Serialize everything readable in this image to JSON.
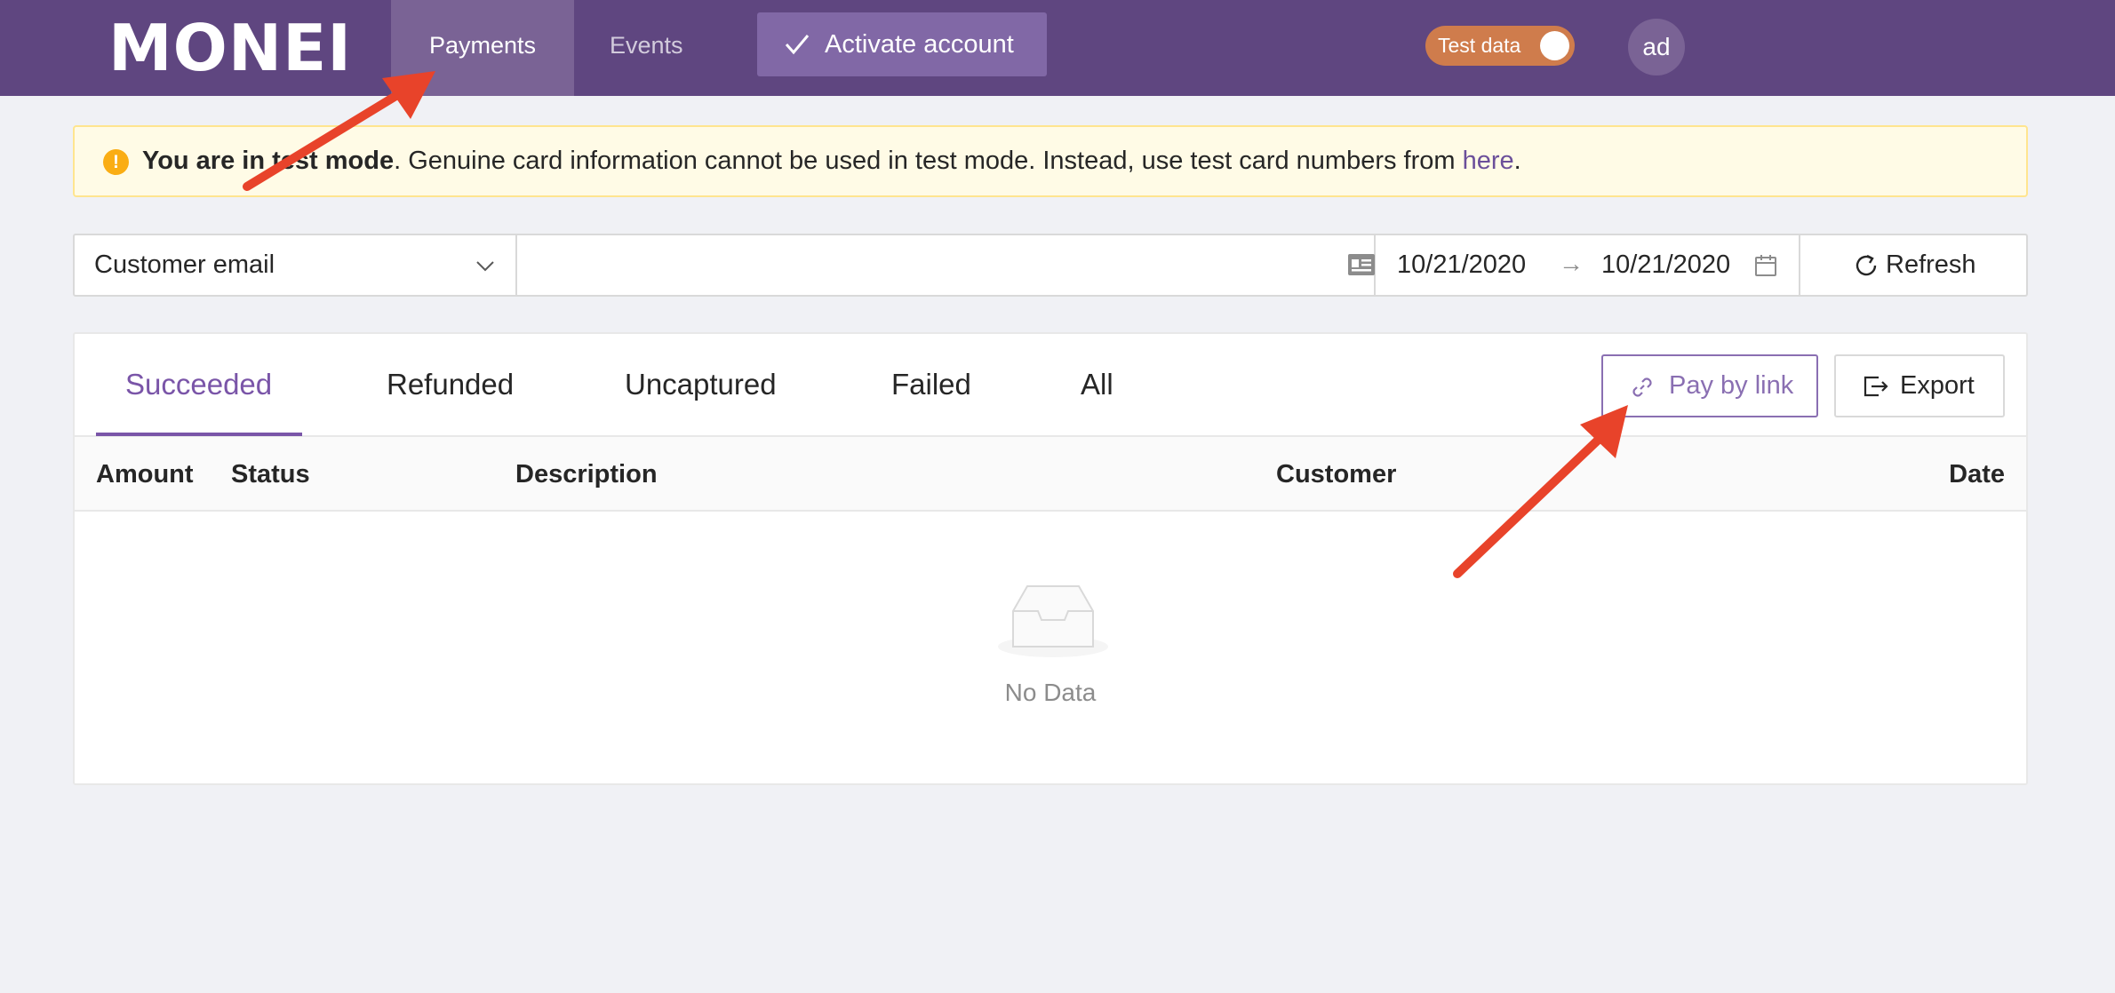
{
  "header": {
    "logo": "MONEI",
    "nav": [
      {
        "label": "Payments"
      },
      {
        "label": "Events"
      }
    ],
    "activate_label": "Activate account",
    "test_toggle_label": "Test data",
    "avatar_initials": "ad"
  },
  "alert": {
    "bold": "You are in test mode",
    "text": ". Genuine card information cannot be used in test mode. Instead, use test card numbers from ",
    "link": "here",
    "end": "."
  },
  "filters": {
    "field_select": "Customer email",
    "search_value": "",
    "date_from": "10/21/2020",
    "date_arrow": "→",
    "date_to": "10/21/2020",
    "refresh_label": "Refresh"
  },
  "tabs": [
    {
      "label": "Succeeded"
    },
    {
      "label": "Refunded"
    },
    {
      "label": "Uncaptured"
    },
    {
      "label": "Failed"
    },
    {
      "label": "All"
    }
  ],
  "actions": {
    "pay_by_link_label": "Pay by link",
    "export_label": "Export"
  },
  "table": {
    "columns": [
      "Amount",
      "Status",
      "Description",
      "Customer",
      "Date"
    ],
    "empty_text": "No Data"
  },
  "colors": {
    "header_bg": "#5f4680",
    "accent": "#7a55a8",
    "test_toggle": "#cf7c4c",
    "annotation_arrow": "#e8432a"
  }
}
